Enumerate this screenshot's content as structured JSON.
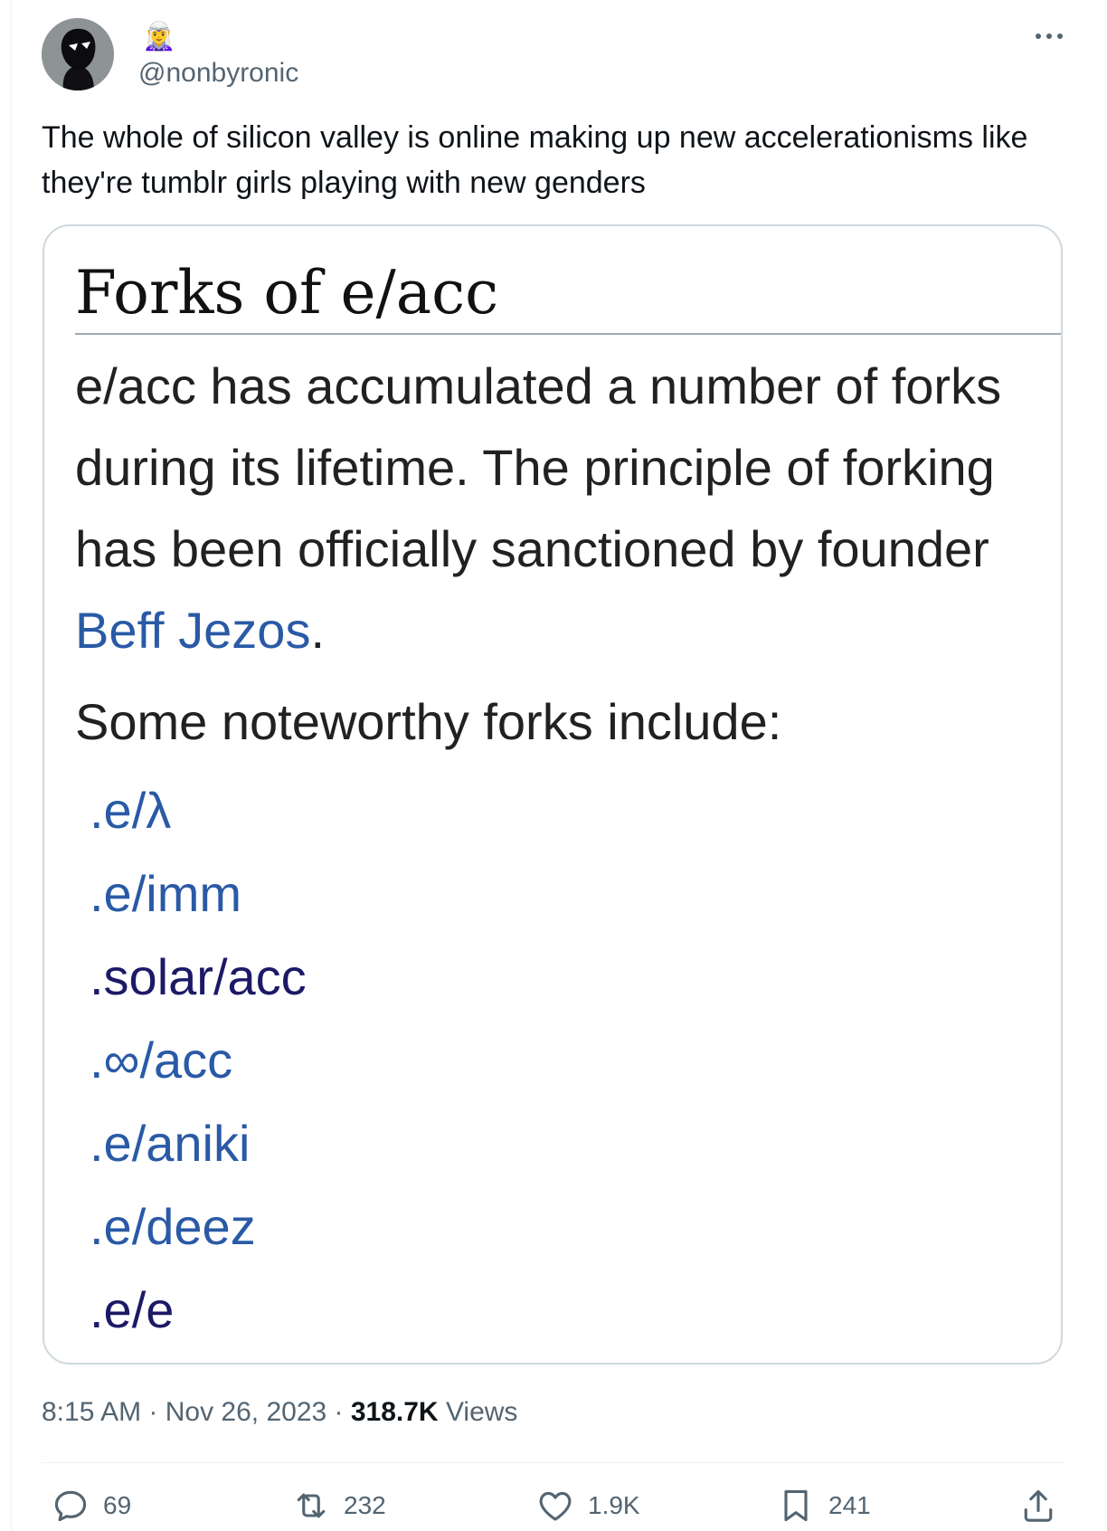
{
  "tweet": {
    "author_badge_emoji": "🧝‍♀️",
    "handle": "@nonbyronic",
    "text_line1": "The whole of silicon valley is online making up new accelerationisms like",
    "text_line2": "they're tumblr girls playing with new genders",
    "timestamp": "8:15 AM · Nov 26, 2023 ·",
    "views_count": "318.7K",
    "views_label": "Views"
  },
  "card": {
    "title": "Forks of e/acc",
    "paragraph_prefix": "e/acc has accumulated a number of forks during its lifetime. The principle of forking has been officially sanctioned by founder ",
    "paragraph_link": "Beff Jezos",
    "paragraph_suffix": ".",
    "intro": "Some noteworthy forks include:",
    "forks": [
      ".e/λ",
      ".e/imm",
      ".solar/acc",
      ".∞/acc",
      ".e/aniki",
      ".e/deez",
      ".e/e"
    ]
  },
  "actions": {
    "replies": "69",
    "reposts": "232",
    "likes": "1.9K",
    "bookmarks": "241"
  },
  "icons": [
    "more-icon",
    "reply-icon",
    "repost-icon",
    "like-icon",
    "bookmark-icon",
    "share-icon"
  ],
  "colors": {
    "link": "#2a5aa6",
    "visited_link": "#1c1a66",
    "secondary_text": "#536471",
    "card_border": "#cfd9de"
  }
}
